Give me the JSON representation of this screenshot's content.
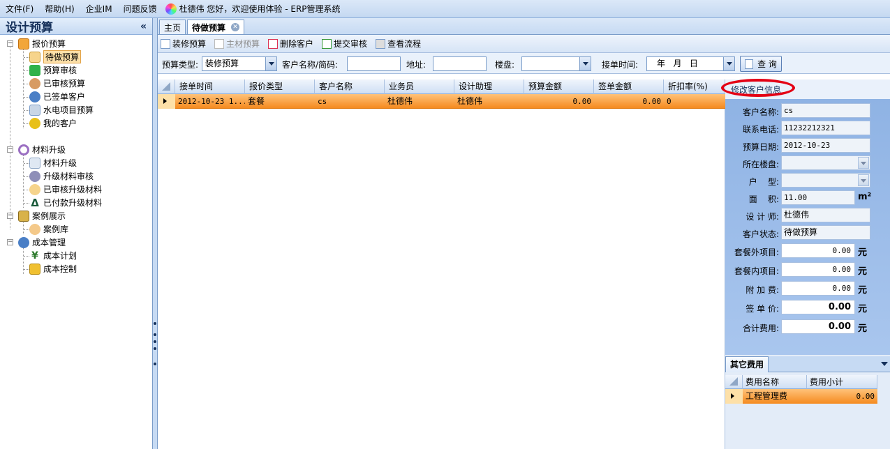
{
  "menu": {
    "items": [
      "文件(F)",
      "帮助(H)",
      "企业IM",
      "问题反馈"
    ],
    "welcome": "杜德伟 您好，欢迎使用体验 - ERP管理系统"
  },
  "sidebar": {
    "title": "设计预算",
    "collapse": "«",
    "groups": [
      {
        "label": "报价预算",
        "children": [
          "待做预算",
          "预算审核",
          "已审核预算",
          "已签单客户",
          "水电项目预算",
          "我的客户"
        ]
      },
      {
        "label": "材料升级",
        "children": [
          "材料升级",
          "升级材料审核",
          "已审核升级材料",
          "已付款升级材料"
        ]
      },
      {
        "label": "案例展示",
        "children": [
          "案例库"
        ]
      },
      {
        "label": "成本管理",
        "children": [
          "成本计划",
          "成本控制"
        ]
      }
    ],
    "selected": "待做预算"
  },
  "tabs": {
    "home": "主页",
    "active": "待做预算"
  },
  "toolbar": {
    "buttons": [
      "装修预算",
      "主材预算",
      "删除客户",
      "提交审核",
      "查看流程"
    ],
    "disabled": "主材预算"
  },
  "filter": {
    "type_label": "预算类型:",
    "type_value": "装修预算",
    "name_label": "客户名称/简码:",
    "name_value": "",
    "addr_label": "地址:",
    "addr_value": "",
    "building_label": "楼盘:",
    "building_value": "",
    "time_label": "接单时间:",
    "time_value": "年   月   日",
    "query": "查 询"
  },
  "grid": {
    "headers": [
      "接单时间",
      "报价类型",
      "客户名称",
      "业务员",
      "设计助理",
      "预算金额",
      "签单金额",
      "折扣率(%)"
    ],
    "rows": [
      [
        "2012-10-23 1...",
        "套餐",
        "cs",
        "杜德伟",
        "杜德伟",
        "0.00",
        "0.00",
        "0"
      ]
    ]
  },
  "detail": {
    "edit_link": "修改客户信息",
    "fields": [
      {
        "label": "客户名称:",
        "value": "cs"
      },
      {
        "label": "联系电话:",
        "value": "11232212321"
      },
      {
        "label": "预算日期:",
        "value": "2012-10-23"
      },
      {
        "label": "所在楼盘:",
        "value": ""
      },
      {
        "label": "户    型:",
        "value": ""
      },
      {
        "label": "面    积:",
        "value": "11.00",
        "unit": "m²"
      },
      {
        "label": "设 计 师:",
        "value": "杜德伟"
      },
      {
        "label": "客户状态:",
        "value": "待做预算"
      },
      {
        "label": "套餐外项目:",
        "value": "0.00",
        "unit": "元"
      },
      {
        "label": "套餐内项目:",
        "value": "0.00",
        "unit": "元"
      },
      {
        "label": "附 加 费:",
        "value": "0.00",
        "unit": "元"
      },
      {
        "label": "签 单 价:",
        "value": "0.00",
        "unit": "元"
      },
      {
        "label": "合计费用:",
        "value": "0.00",
        "unit": "元"
      }
    ]
  },
  "other": {
    "tab": "其它费用",
    "headers": [
      "费用名称",
      "费用小计"
    ],
    "rows": [
      [
        "工程管理费",
        "0.00"
      ]
    ]
  }
}
